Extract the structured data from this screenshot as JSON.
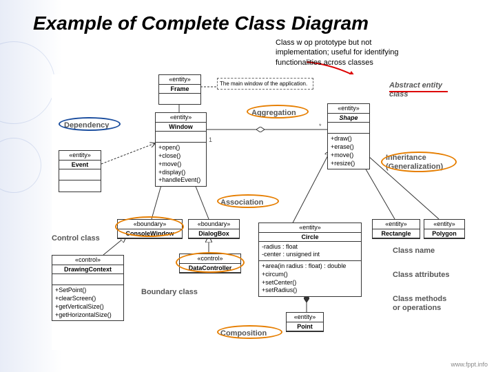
{
  "title": "Example of Complete Class Diagram",
  "note_l1": "Class w op prototype but not",
  "note_l2": "implementation; useful for identifying",
  "note_l3": "functionalities across classes",
  "footer": "www.fppt.info",
  "comment": "The main window of the application.",
  "stereo_entity": "«entity»",
  "stereo_boundary": "«boundary»",
  "stereo_control": "«control»",
  "cls": {
    "frame": "Frame",
    "window": "Window",
    "event": "Event",
    "shape": "Shape",
    "console": "ConsoleWindow",
    "dialog": "DialogBox",
    "circle": "Circle",
    "rect": "Rectangle",
    "poly": "Polygon",
    "point": "Point",
    "drawctx": "DrawingContext",
    "datactl": "DataController"
  },
  "ops": {
    "window": "+open()\n+close()\n+move()\n+display()\n+handleEvent()",
    "shape": "+draw()\n+erase()\n+move()\n+resize()",
    "circle_attr": "-radius : float\n-center : unsigned int",
    "circle_ops": "+area(in radius : float) : double\n+circum()\n+setCenter()\n+setRadius()",
    "drawctx": "+SetPoint()\n+clearScreen()\n+getVerticalSize()\n+getHorizontalSize()"
  },
  "labels": {
    "dependency": "Dependency",
    "aggregation": "Aggregation",
    "association": "Association",
    "inheritance": "Inheritance\n(Generalization)",
    "composition": "Composition",
    "abstract": "Abstract entity\nclass",
    "control": "Control class",
    "boundary": "Boundary class",
    "classname": "Class name",
    "classattr": "Class attributes",
    "classops": "Class methods\nor operations"
  },
  "mult": {
    "one": "1",
    "star": "*"
  }
}
